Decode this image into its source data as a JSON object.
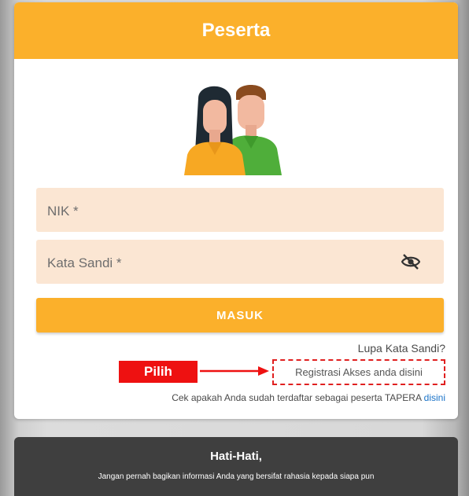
{
  "card": {
    "title": "Peserta",
    "header_color": "#fbb02b"
  },
  "form": {
    "nik_label": "NIK *",
    "password_label": "Kata Sandi  *",
    "password_toggle_icon": "eye-off-icon",
    "submit_label": "MASUK",
    "forgot_password_link": "Lupa Kata Sandi?",
    "register_link": "Registrasi Akses anda disini",
    "check_text": "Cek apakah Anda sudah terdaftar sebagai peserta TAPERA ",
    "check_link": "disini",
    "field_background": "#fbe6d3"
  },
  "annotation": {
    "label": "Pilih",
    "color": "#ee1111"
  },
  "warning": {
    "title": "Hati-Hati,",
    "message": "Jangan pernah bagikan informasi Anda yang bersifat rahasia kepada siapa pun"
  }
}
